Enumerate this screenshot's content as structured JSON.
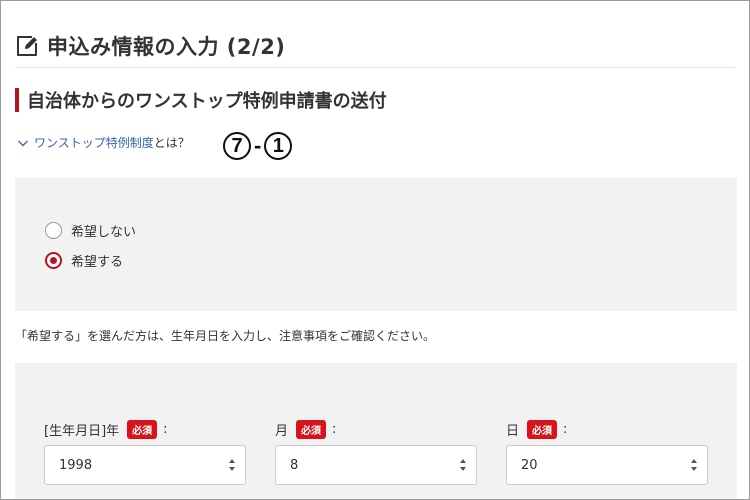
{
  "page": {
    "title": "申込み情報の入力 (2/2)"
  },
  "section": {
    "title": "自治体からのワンストップ特例申請書の送付"
  },
  "info_link": {
    "link_text": "ワンストップ特例制度",
    "suffix": "とは？"
  },
  "annotation": {
    "left": "7",
    "separator": "-",
    "right": "1"
  },
  "radio_options": [
    {
      "label": "希望しない",
      "checked": false
    },
    {
      "label": "希望する",
      "checked": true
    }
  ],
  "note": "「希望する」を選んだ方は、生年月日を入力し、注意事項をご確認ください。",
  "birthdate": {
    "year": {
      "label": "[生年月日]年",
      "required": "必須",
      "colon": ":",
      "value": "1998"
    },
    "month": {
      "label": "月",
      "required": "必須",
      "colon": ":",
      "value": "8"
    },
    "day": {
      "label": "日",
      "required": "必須",
      "colon": ":",
      "value": "20"
    }
  },
  "colors": {
    "accent": "#b7141e",
    "required_badge": "#d7141c",
    "link": "#3a64a8",
    "panel_bg": "#f2f2f2"
  },
  "icons": {
    "title": "edit-form-icon",
    "link": "chevron-down-icon",
    "select": "select-arrows-icon"
  }
}
